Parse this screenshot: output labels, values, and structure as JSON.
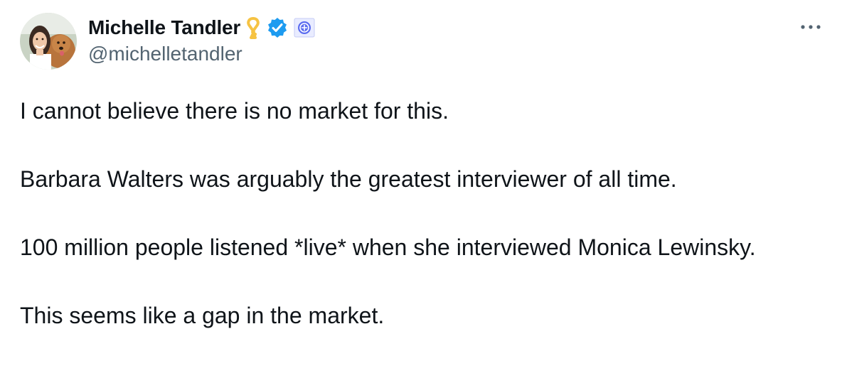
{
  "author": {
    "display_name": "Michelle Tandler",
    "handle": "@michelletandler",
    "avatar_icon": "profile-photo-with-dog",
    "badges": [
      {
        "icon": "yellow-ribbon-icon",
        "color": "#f6c343"
      },
      {
        "icon": "verified-checkmark-icon",
        "color": "#1d9bf0"
      },
      {
        "icon": "affiliate-badge-icon",
        "color": "#5b6cf0"
      }
    ]
  },
  "menu": {
    "more_icon": "more-options-icon"
  },
  "tweet": {
    "paragraphs": [
      "I cannot believe there is no market for this.",
      "Barbara Walters was arguably the greatest interviewer of all time.",
      "100 million people listened *live* when she interviewed Monica Lewinsky.",
      "This seems like a gap in the market."
    ]
  },
  "colors": {
    "text_primary": "#0f1419",
    "text_secondary": "#536471",
    "background": "#ffffff"
  }
}
